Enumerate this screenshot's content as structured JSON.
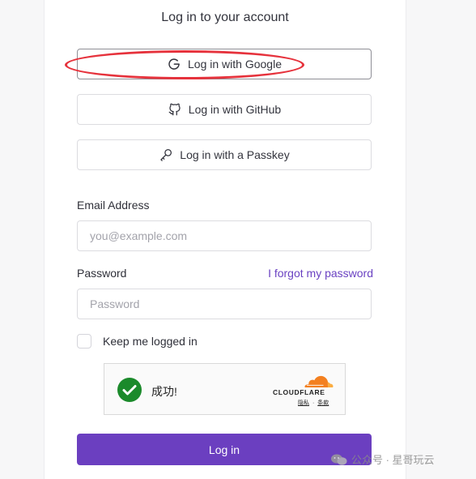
{
  "title": "Log in to your account",
  "oauth": {
    "google_label": "Log in with Google",
    "github_label": "Log in with GitHub",
    "passkey_label": "Log in with a Passkey"
  },
  "form": {
    "email_label": "Email Address",
    "email_placeholder": "you@example.com",
    "password_label": "Password",
    "forgot_label": "I forgot my password",
    "password_placeholder": "Password",
    "keep_logged_in_label": "Keep me logged in",
    "submit_label": "Log in"
  },
  "captcha": {
    "status": "成功!",
    "brand": "CLOUDFLARE",
    "privacy_link": "隐私",
    "separator": "·",
    "terms_link": "条款"
  },
  "watermark": {
    "text": "公众号 · 星哥玩云"
  },
  "colors": {
    "accent": "#6b3fc0",
    "annotation": "#e6323c",
    "success": "#1b8a2b",
    "cloudflare_orange": "#f38020"
  },
  "icons": {
    "google": "google-icon",
    "github": "github-icon",
    "passkey": "key-icon",
    "captcha_success": "check-circle-icon",
    "cloudflare": "cloudflare-logo-icon",
    "watermark": "wechat-icon"
  }
}
